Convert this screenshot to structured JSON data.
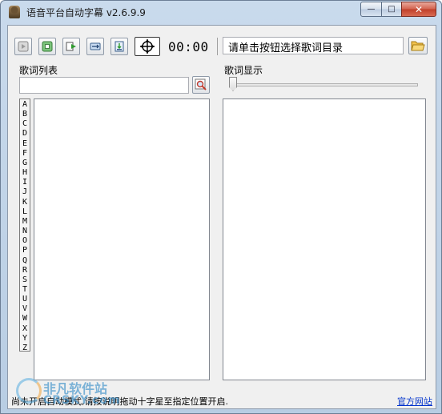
{
  "window": {
    "title": "语音平台自动字幕 v2.6.9.9",
    "controls": {
      "minimize": "—",
      "maximize": "□",
      "close": "✕"
    }
  },
  "toolbar": {
    "buttons": [
      "previous-icon",
      "stop-icon",
      "play-icon",
      "loop-icon",
      "export-icon",
      "crosshair-icon"
    ],
    "time": "00:00",
    "directory_placeholder": "请单击按钮选择歌词目录"
  },
  "left_panel": {
    "label": "歌词列表",
    "alphabet": [
      "A",
      "B",
      "C",
      "D",
      "E",
      "F",
      "G",
      "H",
      "I",
      "J",
      "K",
      "L",
      "M",
      "N",
      "O",
      "P",
      "Q",
      "R",
      "S",
      "T",
      "U",
      "V",
      "W",
      "X",
      "Y",
      "Z"
    ]
  },
  "right_panel": {
    "label": "歌词显示",
    "slider_value": 0
  },
  "status": {
    "message": "尚未开启自动模式,请按说明拖动十字星至指定位置开启.",
    "link": "官方网站"
  },
  "watermark": {
    "cn": "非凡软件站",
    "en": "CRSKY.com"
  },
  "colors": {
    "titlebar": "#c9daec",
    "client_bg": "#f0f0f0",
    "link": "#0033cc",
    "close_button": "#c0402a"
  }
}
